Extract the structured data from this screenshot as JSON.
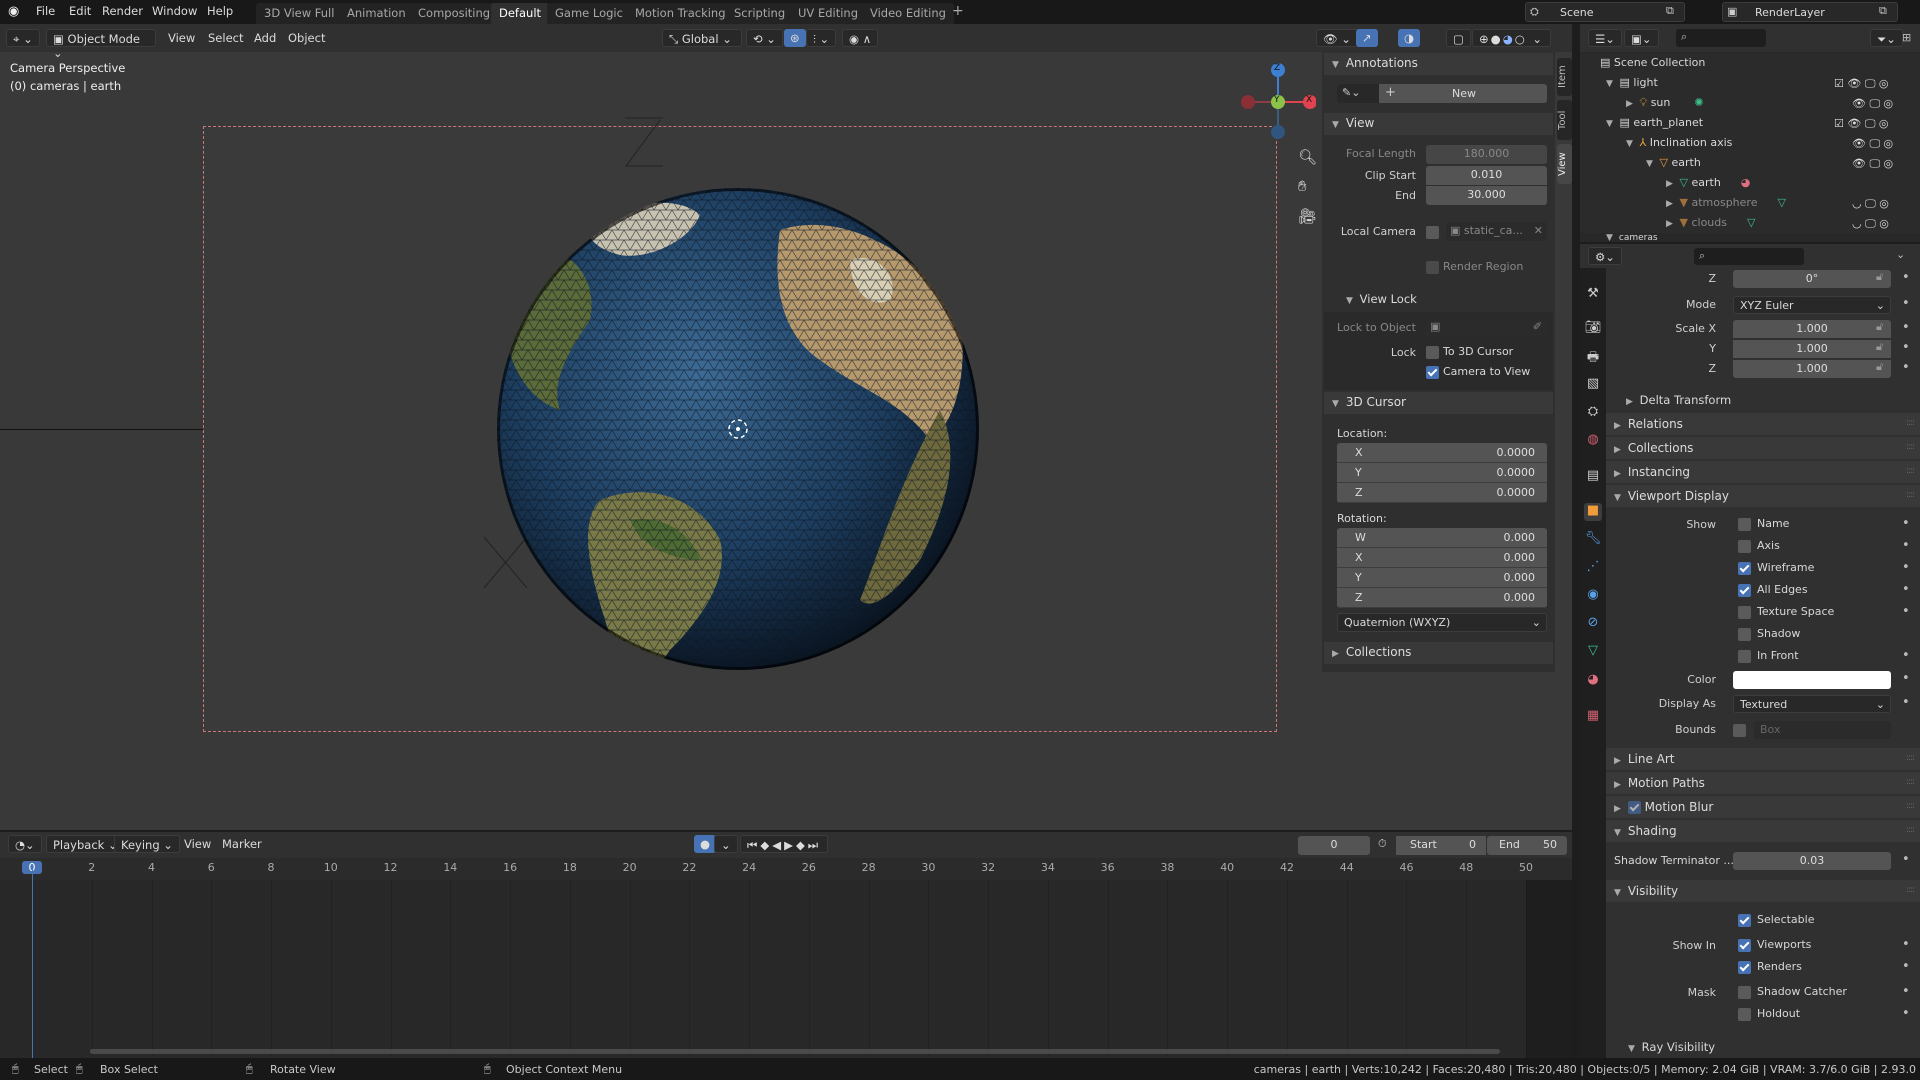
{
  "topbar": {
    "menus": [
      "File",
      "Edit",
      "Render",
      "Window",
      "Help"
    ],
    "workspaces": [
      "3D View Full",
      "Animation",
      "Compositing",
      "Default",
      "Game Logic",
      "Motion Tracking",
      "Scripting",
      "UV Editing",
      "Video Editing"
    ],
    "active_workspace": "Default",
    "add_tab": "+",
    "scene": "Scene",
    "render_layer": "RenderLayer"
  },
  "viewport": {
    "mode": "Object Mode",
    "menus": [
      "View",
      "Select",
      "Add",
      "Object"
    ],
    "orientation": "Global",
    "overlay_title": "Camera Perspective",
    "overlay_subtitle": "(0) cameras | earth",
    "gizmo": {
      "x": "X",
      "y": "Y",
      "z": "Z"
    }
  },
  "npanel": {
    "tabs": [
      "Item",
      "Tool",
      "View"
    ],
    "active_tab": "View",
    "annotations": {
      "title": "Annotations",
      "new_label": "New"
    },
    "view": {
      "title": "View",
      "focal_length_label": "Focal Length",
      "focal_length": "180.000",
      "clip_start_label": "Clip Start",
      "clip_start": "0.010",
      "clip_end_label": "End",
      "clip_end": "30.000",
      "local_camera_label": "Local Camera",
      "local_camera": "static_ca...",
      "render_region_label": "Render Region"
    },
    "view_lock": {
      "title": "View Lock",
      "lock_to_object_label": "Lock to Object",
      "lock_label": "Lock",
      "to_3d_cursor": "To 3D Cursor",
      "to_3d_cursor_checked": false,
      "camera_to_view": "Camera to View",
      "camera_to_view_checked": true
    },
    "cursor": {
      "title": "3D Cursor",
      "location_label": "Location:",
      "location": [
        {
          "axis": "X",
          "value": "0.0000"
        },
        {
          "axis": "Y",
          "value": "0.0000"
        },
        {
          "axis": "Z",
          "value": "0.0000"
        }
      ],
      "rotation_label": "Rotation:",
      "rotation": [
        {
          "axis": "W",
          "value": "0.000"
        },
        {
          "axis": "X",
          "value": "0.000"
        },
        {
          "axis": "Y",
          "value": "0.000"
        },
        {
          "axis": "Z",
          "value": "0.000"
        }
      ],
      "rotation_mode": "Quaternion (WXYZ)"
    },
    "collections_title": "Collections"
  },
  "outliner": {
    "rows": [
      {
        "label": "Scene Collection"
      },
      {
        "label": "light"
      },
      {
        "label": "sun"
      },
      {
        "label": "earth_planet"
      },
      {
        "label": "Inclination axis"
      },
      {
        "label": "earth"
      },
      {
        "label": "earth"
      },
      {
        "label": "atmosphere"
      },
      {
        "label": "clouds"
      },
      {
        "label": "cameras"
      }
    ]
  },
  "properties": {
    "rot_z_label": "Z",
    "rot_z": "0°",
    "mode_label": "Mode",
    "mode": "XYZ Euler",
    "scale_x_label": "Scale X",
    "scale_x": "1.000",
    "scale_y_label": "Y",
    "scale_y": "1.000",
    "scale_z_label": "Z",
    "scale_z": "1.000",
    "delta_transform": "Delta Transform",
    "relations": "Relations",
    "collections": "Collections",
    "instancing": "Instancing",
    "viewport_display": "Viewport Display",
    "show_label": "Show",
    "show": [
      {
        "label": "Name",
        "checked": false
      },
      {
        "label": "Axis",
        "checked": false
      },
      {
        "label": "Wireframe",
        "checked": true
      },
      {
        "label": "All Edges",
        "checked": true
      },
      {
        "label": "Texture Space",
        "checked": false
      },
      {
        "label": "Shadow",
        "checked": false
      },
      {
        "label": "In Front",
        "checked": false
      }
    ],
    "color_label": "Color",
    "color": "#ffffff",
    "display_as_label": "Display As",
    "display_as": "Textured",
    "bounds_label": "Bounds",
    "bounds": "Box",
    "line_art": "Line Art",
    "motion_paths": "Motion Paths",
    "motion_blur": "Motion Blur",
    "shading": "Shading",
    "shadow_terminator_label": "Shadow Terminator ...",
    "shadow_terminator": "0.03",
    "visibility": "Visibility",
    "selectable": "Selectable",
    "show_in_label": "Show In",
    "viewports": "Viewports",
    "renders": "Renders",
    "mask_label": "Mask",
    "shadow_catcher": "Shadow Catcher",
    "holdout": "Holdout",
    "ray_visibility": "Ray Visibility"
  },
  "timeline": {
    "menus": [
      "Playback",
      "Keying",
      "View",
      "Marker"
    ],
    "current_frame": "0",
    "start_label": "Start",
    "start": "0",
    "end_label": "End",
    "end": "50",
    "ticks": [
      "0",
      "2",
      "4",
      "6",
      "8",
      "10",
      "12",
      "14",
      "16",
      "18",
      "20",
      "22",
      "24",
      "26",
      "28",
      "30",
      "32",
      "34",
      "36",
      "38",
      "40",
      "42",
      "44",
      "46",
      "48",
      "50"
    ]
  },
  "status": {
    "select": "Select",
    "box_select": "Box Select",
    "rotate_view": "Rotate View",
    "context_menu": "Object Context Menu",
    "stats": "cameras | earth | Verts:10,242 | Faces:20,480 | Tris:20,480 | Objects:0/5 | Memory: 2.04 GiB | VRAM: 3.7/6.0 GiB | 2.93.0"
  },
  "colors": {
    "accent": "#4772b3",
    "selected_object": "#f09d3a",
    "gizmo_x": "#e0424f",
    "gizmo_y": "#8bc34a",
    "gizmo_z": "#3d7fd1"
  }
}
